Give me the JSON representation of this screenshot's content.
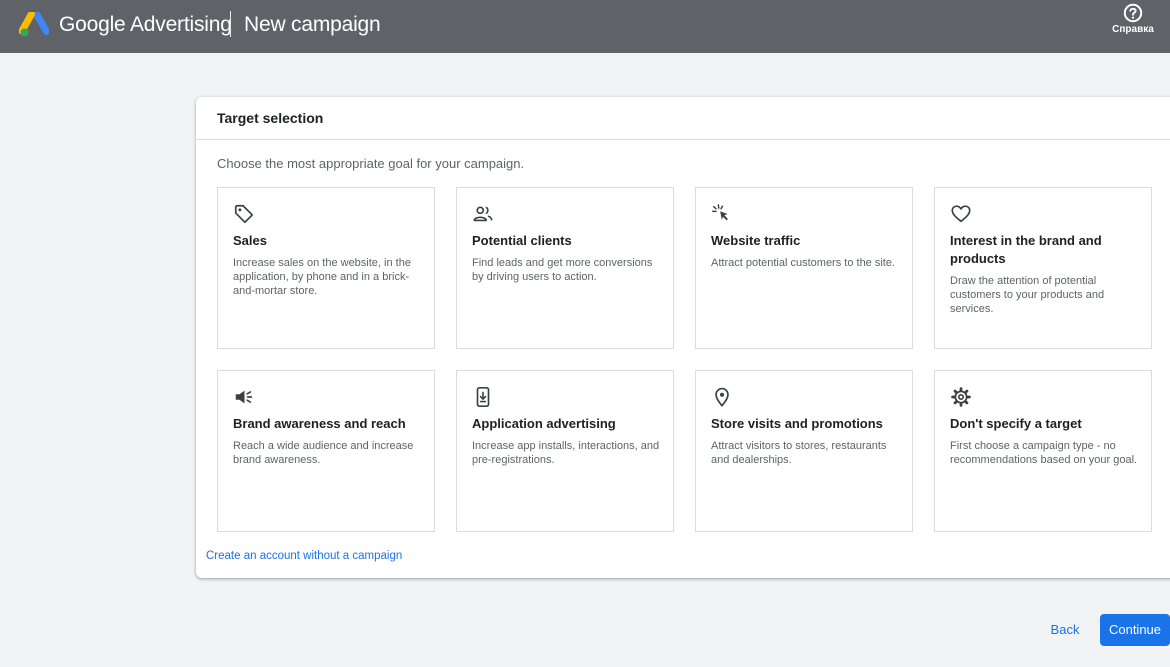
{
  "header": {
    "brand": "Google Advertising",
    "page_title": "New campaign",
    "help_label": "Справка"
  },
  "card": {
    "title": "Target selection",
    "subtitle": "Choose the most appropriate goal for your campaign.",
    "goals": [
      {
        "icon": "tag-icon",
        "title": "Sales",
        "description": "Increase sales on the website, in the application, by phone and in a brick-and-mortar store."
      },
      {
        "icon": "people-icon",
        "title": "Potential clients",
        "description": "Find leads and get more conversions by driving users to action."
      },
      {
        "icon": "cursor-click-icon",
        "title": "Website traffic",
        "description": "Attract potential customers to the site."
      },
      {
        "icon": "heart-icon",
        "title": "Interest in the brand and products",
        "description": "Draw the attention of potential customers to your products and services."
      },
      {
        "icon": "megaphone-icon",
        "title": "Brand awareness and reach",
        "description": "Reach a wide audience and increase brand awareness."
      },
      {
        "icon": "phone-download-icon",
        "title": "Application advertising",
        "description": "Increase app installs, interactions, and pre-registrations."
      },
      {
        "icon": "location-pin-icon",
        "title": "Store visits and promotions",
        "description": "Attract visitors to stores, restaurants and dealerships."
      },
      {
        "icon": "gear-icon",
        "title": "Don't specify a target",
        "description": "First choose a campaign type - no recommendations based on your goal."
      }
    ],
    "no_campaign_link": "Create an account without a campaign"
  },
  "footer": {
    "back_label": "Back",
    "continue_label": "Continue"
  },
  "colors": {
    "header_bg": "#5f6368",
    "page_bg": "#f1f3f4",
    "accent": "#1a73e8"
  }
}
